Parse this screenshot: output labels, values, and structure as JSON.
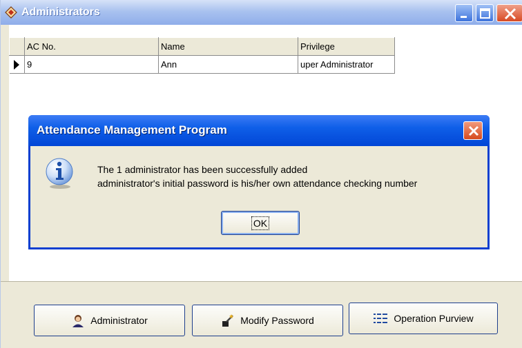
{
  "window": {
    "title": "Administrators",
    "colors": {
      "titlebar": "#8fadea",
      "face": "#ece9d8"
    }
  },
  "grid": {
    "columns": [
      "AC No.",
      "Name",
      "Privilege"
    ],
    "rows": [
      {
        "ac_no": "9",
        "name": "Ann",
        "privilege": "uper Administrator"
      }
    ]
  },
  "dialog": {
    "title": "Attendance Management Program",
    "line1": "The 1 administrator has been successfully added",
    "line2": "administrator's initial password is his/her own attendance checking number",
    "ok_label": "OK",
    "icon": "info-icon"
  },
  "buttons": {
    "administrator": "Administrator",
    "modify_password": "Modify Password",
    "operation_purview": "Operation Purview"
  }
}
